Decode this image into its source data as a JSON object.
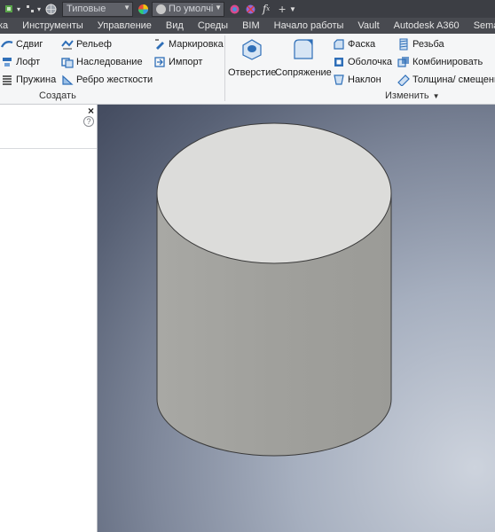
{
  "quick_access": {
    "style_dropdown": "Типовые",
    "material_dropdown": "По умолчі",
    "fx_label": "f"
  },
  "tabs": [
    "ка",
    "Инструменты",
    "Управление",
    "Вид",
    "Среды",
    "BIM",
    "Начало работы",
    "Vault",
    "Autodesk A360",
    "Semantic"
  ],
  "ribbon": {
    "create": {
      "label": "Создать",
      "col1": [
        "Сдвиг",
        "Лофт",
        "Пружина"
      ],
      "col2": [
        "Рельеф",
        "Наследование",
        "Ребро жесткости"
      ],
      "col3": [
        "Маркировка",
        "Импорт"
      ]
    },
    "modify": {
      "label": "Изменить",
      "big1": "Отверстие",
      "big2": "Сопряжение",
      "col1": [
        "Фаска",
        "Оболочка",
        "Наклон"
      ],
      "col2": [
        "Резьба",
        "Комбинировать",
        "Толщина/ смещение"
      ]
    }
  },
  "panel": {
    "close": "×",
    "help": "?"
  },
  "viewport": {
    "model": "cylinder"
  },
  "colors": {
    "qat_bg": "#3c3e44",
    "tabs_bg": "#484a50",
    "ribbon_bg": "#f5f6f7",
    "cylinder_top": "#dcdcda",
    "cylinder_side": "#a2a29e"
  }
}
